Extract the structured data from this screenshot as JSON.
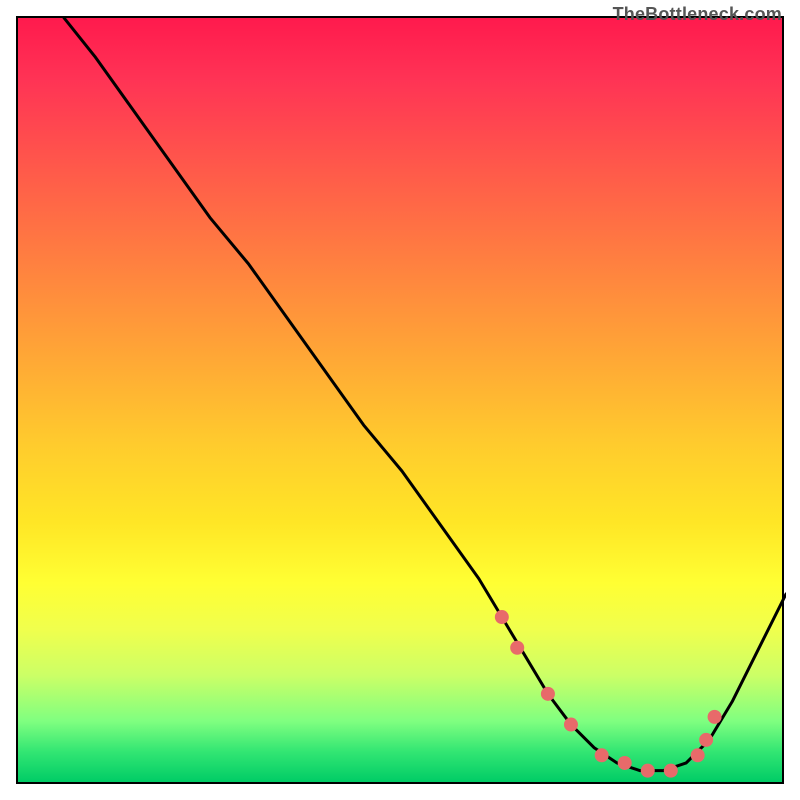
{
  "watermark": "TheBottleneck.com",
  "chart_data": {
    "type": "line",
    "title": "",
    "xlabel": "",
    "ylabel": "",
    "xlim": [
      0,
      100
    ],
    "ylim": [
      0,
      100
    ],
    "grid": false,
    "series": [
      {
        "name": "curve",
        "x": [
          6,
          10,
          15,
          20,
          25,
          30,
          35,
          40,
          45,
          50,
          55,
          60,
          63,
          66,
          69,
          72,
          75,
          78,
          81,
          84,
          87,
          90,
          93,
          96,
          100
        ],
        "y": [
          100,
          95,
          88,
          81,
          74,
          68,
          61,
          54,
          47,
          41,
          34,
          27,
          22,
          17,
          12,
          8,
          5,
          3,
          2,
          2,
          3,
          6,
          11,
          17,
          25
        ]
      }
    ],
    "markers": {
      "name": "highlight-dots",
      "color": "#e86a6a",
      "radius": 7,
      "x": [
        63,
        65,
        69,
        72,
        76,
        79,
        82,
        85,
        88.5,
        89.6,
        90.7
      ],
      "y": [
        22,
        18,
        12,
        8,
        4,
        3,
        2,
        2,
        4,
        6,
        9
      ]
    },
    "colors": {
      "gradient_top": "#ff1a4d",
      "gradient_mid": "#ffe626",
      "gradient_bottom": "#00cc66",
      "curve": "#000000",
      "marker": "#e86a6a"
    }
  }
}
